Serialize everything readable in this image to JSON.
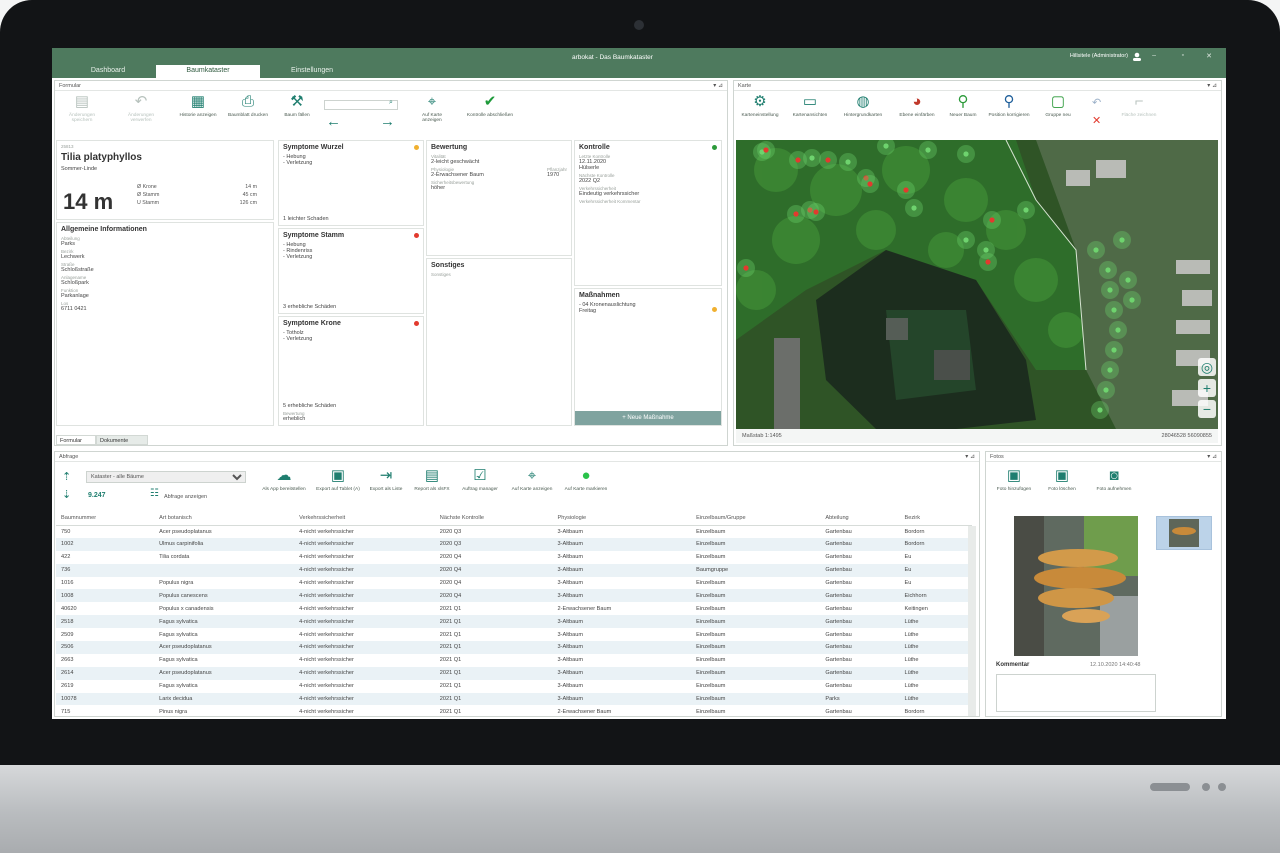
{
  "app": {
    "title": "arbokat - Das Baumkataster",
    "user": "Hillsitele (Administrator)"
  },
  "tabs": [
    {
      "label": "Dashboard"
    },
    {
      "label": "Baumkataster"
    },
    {
      "label": "Einstellungen"
    }
  ],
  "panels": {
    "form": "Formular",
    "map": "Karte",
    "queries": "Abfrage",
    "photos": "Fotos"
  },
  "form_toolbar": {
    "save": "Änderungen speichern",
    "undo": "Änderungen verwerfen",
    "history": "Historie anzeigen",
    "print": "Baumblatt drucken",
    "fell": "Baum fällen",
    "show_on_map": "Auf Karte anzeigen",
    "complete": "Kontrolle abschließen",
    "search_value": ""
  },
  "tree": {
    "number": "25813",
    "species": "Tilia platyphyllos",
    "common_name": "Sommer-Linde",
    "height": "14 m",
    "metrics": [
      {
        "k": "Ø Krone",
        "v": "14 m"
      },
      {
        "k": "Ø Stamm",
        "v": "45 cm"
      },
      {
        "k": "U Stamm",
        "v": "126 cm"
      }
    ],
    "general_title": "Allgemeine Informationen",
    "general": [
      {
        "k": "Abteilung",
        "v": "Parks"
      },
      {
        "k": "Bezirk",
        "v": "Lechwerk"
      },
      {
        "k": "Straße",
        "v": "Schloßstraße"
      },
      {
        "k": "Anlagename",
        "v": "Schloßpark"
      },
      {
        "k": "Funktion",
        "v": "Parkanlage"
      },
      {
        "k": "Los",
        "v": "6711 0421"
      }
    ]
  },
  "symptoms": {
    "roots": {
      "title": "Symptome Wurzel",
      "items": [
        "- Hebung",
        "- Verletzung"
      ],
      "footer": "1 leichter Schaden"
    },
    "trunk": {
      "title": "Symptome Stamm",
      "items": [
        "- Hebung",
        "- Rindenriss",
        "- Verletzung"
      ],
      "footer": "3 erhebliche Schäden"
    },
    "crown": {
      "title": "Symptome Krone",
      "items": [
        "- Totholz",
        "- Verletzung"
      ],
      "footer": "5 erhebliche Schäden",
      "footer_label": "Bewertung",
      "footer_value": "erheblich"
    }
  },
  "assessment": {
    "title": "Bewertung",
    "vitality_label": "Vitalität",
    "vitality": "2-leicht geschwächt",
    "physiology_label": "Physiologie",
    "physiology": "2-Erwachsener Baum",
    "planting_label": "Pflanzjahr",
    "planting": "1970",
    "safety_label": "Sicherheitsbewertung",
    "safety": "höher"
  },
  "other": {
    "title": "Sonstiges",
    "subtitle": "Sonstiges"
  },
  "control": {
    "title": "Kontrolle",
    "last_label": "Letzte Kontrolle",
    "last": "12.11.2020",
    "person": "Hülserle",
    "next_label": "Nächste Kontrolle",
    "next": "2022 Q2",
    "safety_label": "Verkehrssicherheit",
    "safety": "Eindeutig verkehrssicher",
    "comment_label": "Verkehrssicherheit Kommentar"
  },
  "measures": {
    "title": "Maßnahmen",
    "items": [
      "- 04 Kronenauslichtung",
      "  Freitag"
    ],
    "button": "+ Neue Maßnahme"
  },
  "form_tabs": [
    "Formular",
    "Dokumente"
  ],
  "map_toolbar": {
    "settings": "Karteneinstellung",
    "views": "Kartenansichten",
    "background": "Hintergrundkarten",
    "layers": "Ebene einfärben",
    "new_tree": "Neuer Baum",
    "position": "Position korrigieren",
    "group": "Gruppe neu",
    "area": "Fläche zeichnen"
  },
  "map": {
    "scale": "Maßstab 1:1495",
    "coords": "28046528 56090855",
    "colors": {
      "red": "#e23a2e",
      "green": "#6ed36e"
    }
  },
  "queries": {
    "select_value": "Kataster - alle Bäume",
    "count": "9.247",
    "show_queries": "Abfrage anzeigen",
    "tools": [
      "Als App bereitstellen",
      "Export auf Tablet (A)",
      "Export als Liste",
      "Report als xlsFX",
      "Auftrag manager",
      "Auf Karte anzeigen",
      "Auf Karte markieren"
    ]
  },
  "table": {
    "columns": [
      "Baumnummer",
      "Art botanisch",
      "Verkehrssicherheit",
      "Nächste Kontrolle",
      "Physiologie",
      "Einzelbaum/Gruppe",
      "Abteilung",
      "Bezirk"
    ],
    "rows": [
      [
        "750",
        "Acer pseudoplatanus",
        "4-nicht verkehrssicher",
        "2020 Q3",
        "3-Altbaum",
        "Einzelbaum",
        "Gartenbau",
        "Bordorn"
      ],
      [
        "1002",
        "Ulmus carpinifolia",
        "4-nicht verkehrssicher",
        "2020 Q3",
        "3-Altbaum",
        "Einzelbaum",
        "Gartenbau",
        "Bordorn"
      ],
      [
        "422",
        "Tilia cordata",
        "4-nicht verkehrssicher",
        "2020 Q4",
        "3-Altbaum",
        "Einzelbaum",
        "Gartenbau",
        "Eu"
      ],
      [
        "736",
        "",
        "4-nicht verkehrssicher",
        "2020 Q4",
        "3-Altbaum",
        "Baumgruppe",
        "Gartenbau",
        "Eu"
      ],
      [
        "1016",
        "Populus nigra",
        "4-nicht verkehrssicher",
        "2020 Q4",
        "3-Altbaum",
        "Einzelbaum",
        "Gartenbau",
        "Eu"
      ],
      [
        "1008",
        "Populus canescens",
        "4-nicht verkehrssicher",
        "2020 Q4",
        "3-Altbaum",
        "Einzelbaum",
        "Gartenbau",
        "Eichhorn"
      ],
      [
        "40620",
        "Populus x canadensis",
        "4-nicht verkehrssicher",
        "2021 Q1",
        "2-Erwachsener Baum",
        "Einzelbaum",
        "Gartenbau",
        "Keitingen"
      ],
      [
        "2518",
        "Fagus sylvatica",
        "4-nicht verkehrssicher",
        "2021 Q1",
        "3-Altbaum",
        "Einzelbaum",
        "Gartenbau",
        "Lüthe"
      ],
      [
        "2509",
        "Fagus sylvatica",
        "4-nicht verkehrssicher",
        "2021 Q1",
        "3-Altbaum",
        "Einzelbaum",
        "Gartenbau",
        "Lüthe"
      ],
      [
        "2506",
        "Acer pseudoplatanus",
        "4-nicht verkehrssicher",
        "2021 Q1",
        "3-Altbaum",
        "Einzelbaum",
        "Gartenbau",
        "Lüthe"
      ],
      [
        "2663",
        "Fagus sylvatica",
        "4-nicht verkehrssicher",
        "2021 Q1",
        "3-Altbaum",
        "Einzelbaum",
        "Gartenbau",
        "Lüthe"
      ],
      [
        "2614",
        "Acer pseudoplatanus",
        "4-nicht verkehrssicher",
        "2021 Q1",
        "3-Altbaum",
        "Einzelbaum",
        "Gartenbau",
        "Lüthe"
      ],
      [
        "2619",
        "Fagus sylvatica",
        "4-nicht verkehrssicher",
        "2021 Q1",
        "3-Altbaum",
        "Einzelbaum",
        "Gartenbau",
        "Lüthe"
      ],
      [
        "10078",
        "Larix decidua",
        "4-nicht verkehrssicher",
        "2021 Q1",
        "3-Altbaum",
        "Einzelbaum",
        "Parks",
        "Lüthe"
      ],
      [
        "715",
        "Pinus nigra",
        "4-nicht verkehrssicher",
        "2021 Q1",
        "2-Erwachsener Baum",
        "Einzelbaum",
        "Gartenbau",
        "Bordorn"
      ]
    ]
  },
  "photos_panel": {
    "add": "Foto hinzufügen",
    "delete": "Foto löschen",
    "capture": "Foto aufnehmen",
    "comment_label": "Kommentar",
    "comment_date": "12.10.2020 14:40:48",
    "comment": ""
  }
}
